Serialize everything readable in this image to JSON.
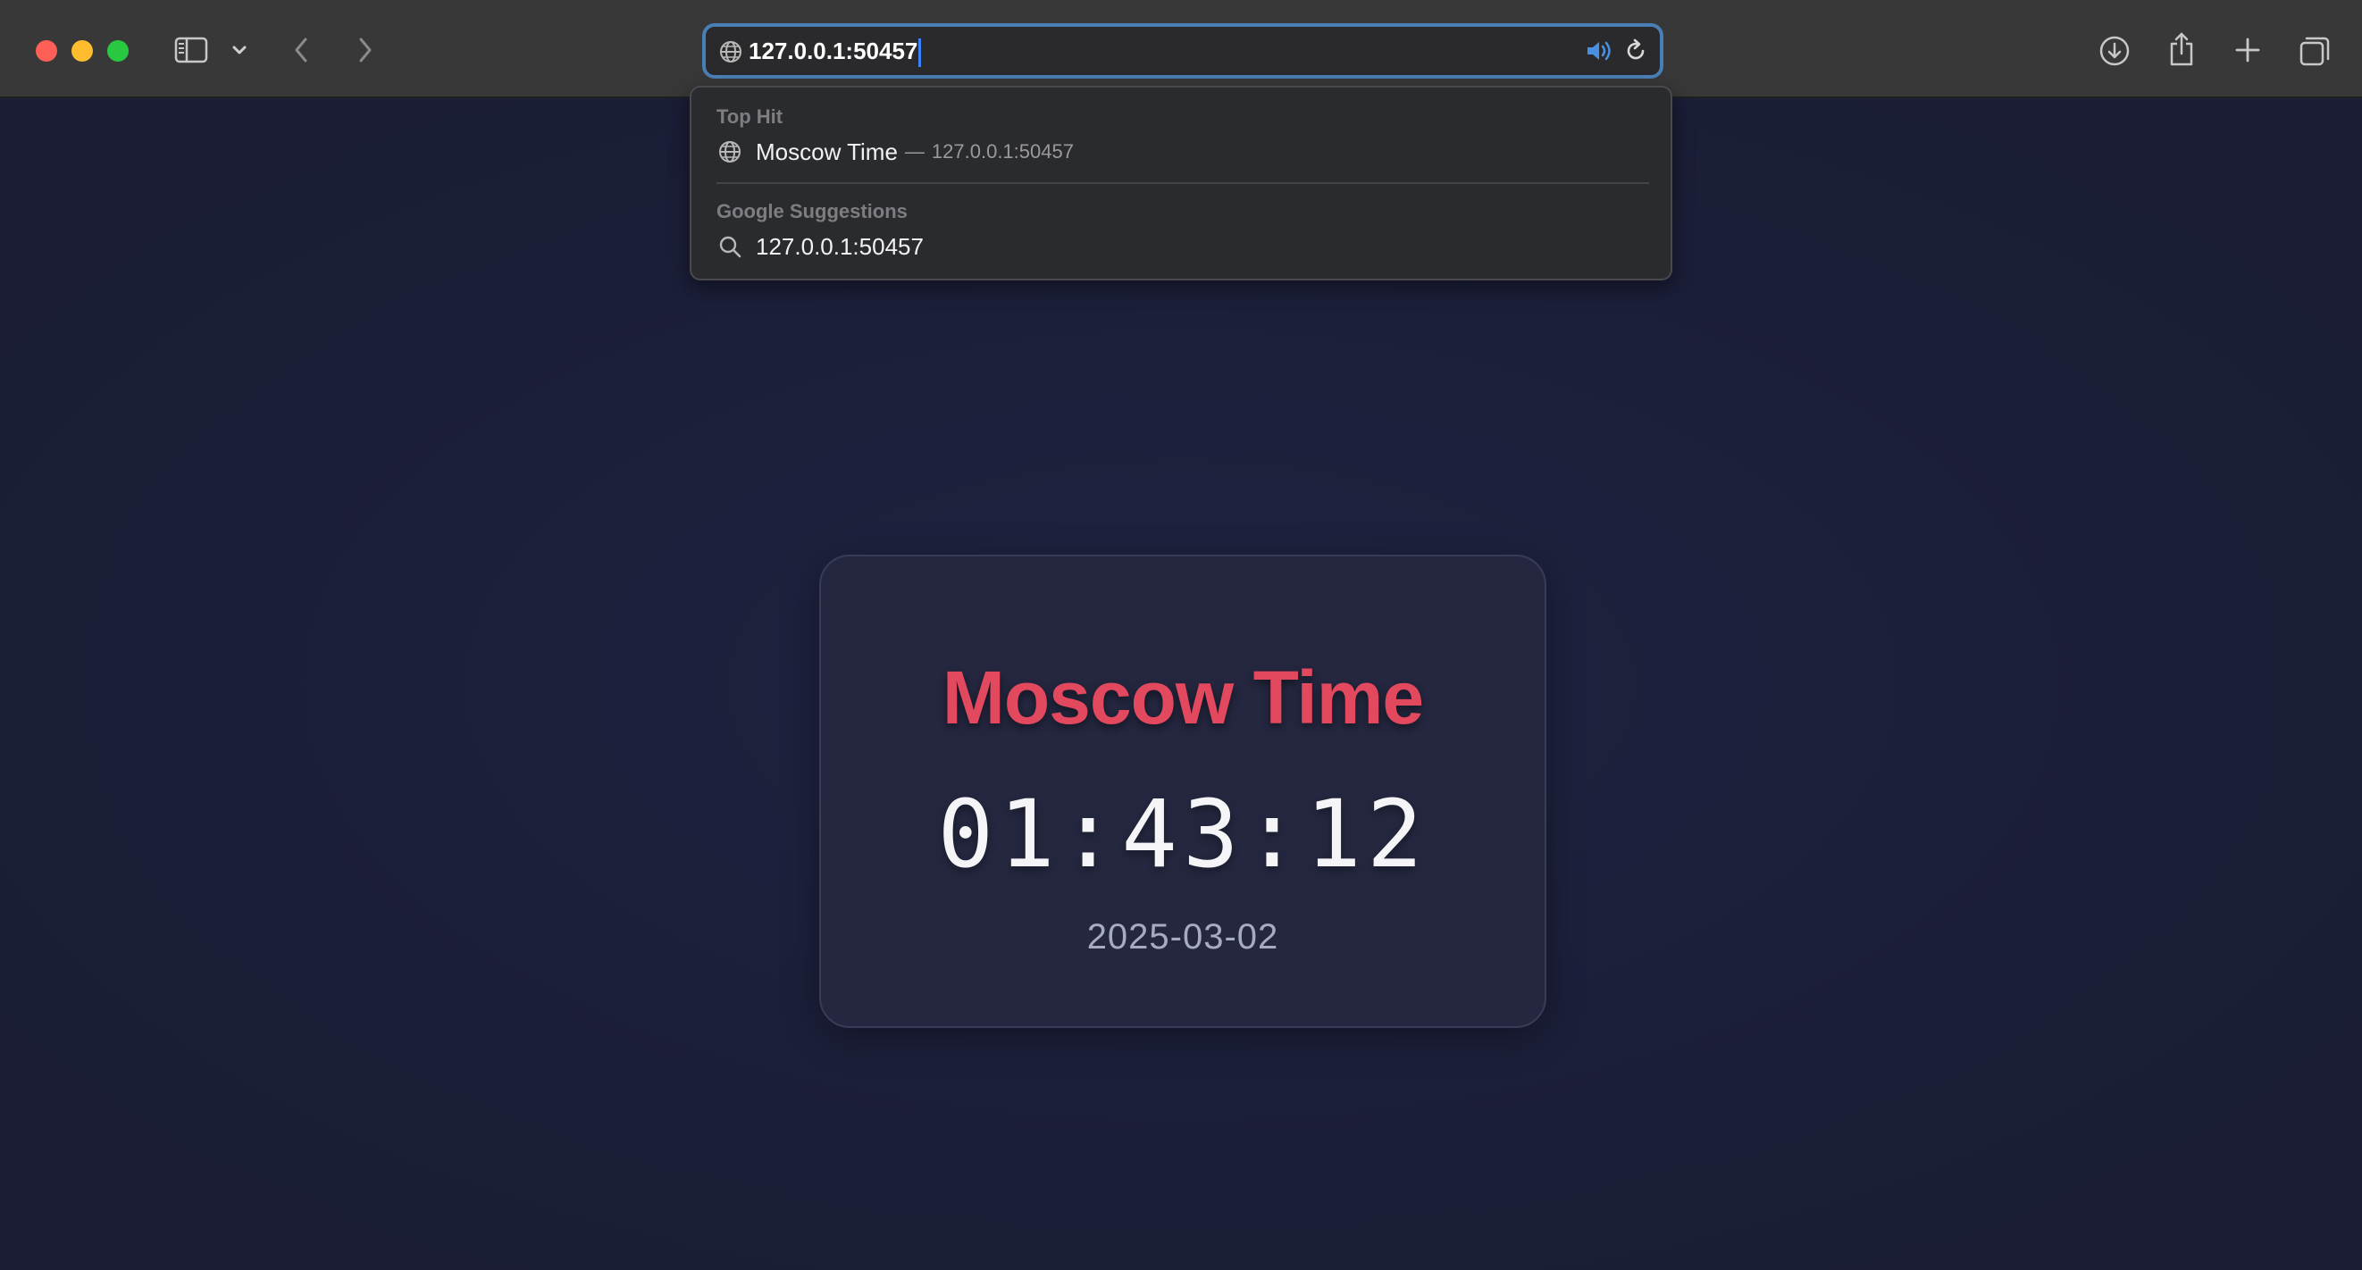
{
  "browser": {
    "address_bar": {
      "url": "127.0.0.1:50457"
    },
    "icons": {
      "sidebar": "sidebar-icon",
      "tab_overview_chevron": "chevron-down-icon",
      "back": "chevron-left-icon",
      "forward": "chevron-right-icon",
      "site": "globe-icon",
      "audio": "speaker-icon",
      "reload": "reload-icon",
      "downloads": "download-icon",
      "share": "share-icon",
      "new_tab": "plus-icon",
      "tab_overview": "tabs-icon"
    },
    "colors": {
      "accent": "#4a7fb6",
      "traffic_red": "#fe5f57",
      "traffic_yellow": "#febc2e",
      "traffic_green": "#28c840"
    }
  },
  "suggestions": {
    "top_hit_heading": "Top Hit",
    "top_hit": {
      "title": "Moscow Time",
      "separator": "—",
      "url": "127.0.0.1:50457"
    },
    "google_heading": "Google Suggestions",
    "google_item": "127.0.0.1:50457"
  },
  "page": {
    "title": "Moscow Time",
    "time": "01:43:12",
    "date": "2025-03-02",
    "colors": {
      "title": "#e2485e",
      "background": "#1c1f37",
      "card": "#24273f"
    }
  }
}
